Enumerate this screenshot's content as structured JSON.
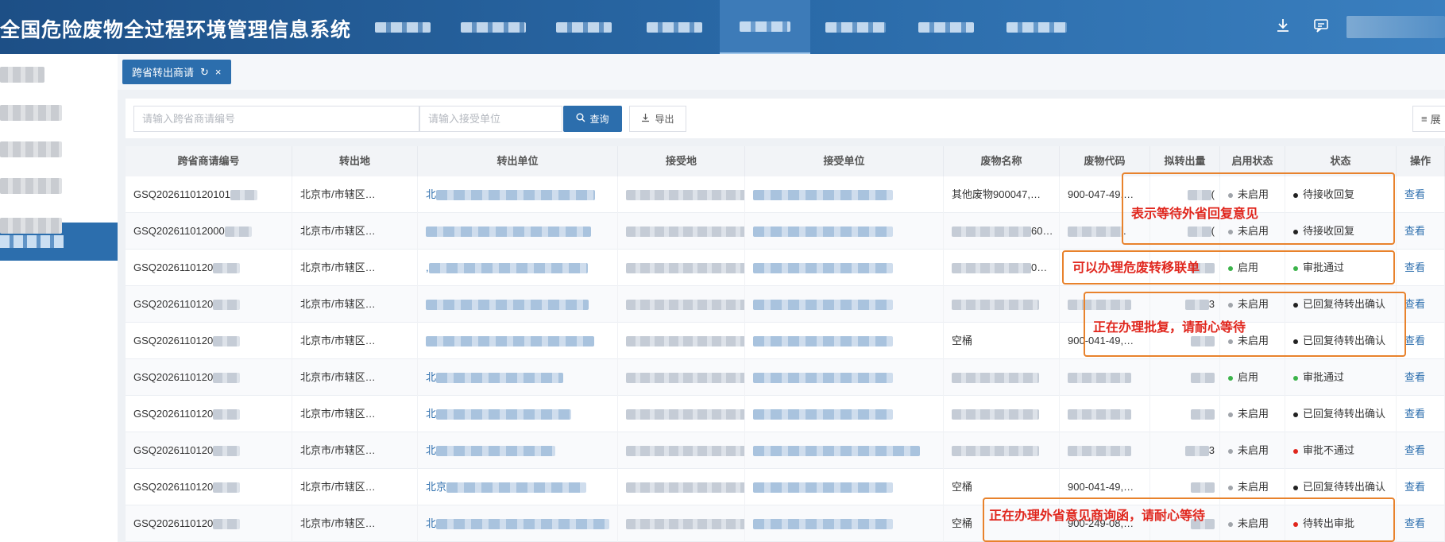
{
  "header": {
    "title": "全国危险废物全过程环境管理信息系统",
    "nav_count": 8,
    "active_nav_index": 4,
    "icons": [
      "download-icon",
      "message-icon"
    ]
  },
  "tabs": [
    {
      "label": "跨省转出商请",
      "refresh_icon": "↻",
      "close_icon": "×"
    }
  ],
  "search": {
    "apply_no_placeholder": "请输入跨省商请编号",
    "receiver_placeholder": "请输入接受单位",
    "query_label": "查询",
    "export_label": "导出",
    "right_label": "展"
  },
  "table": {
    "columns": [
      "跨省商请编号",
      "转出地",
      "转出单位",
      "接受地",
      "接受单位",
      "废物名称",
      "废物代码",
      "拟转出量",
      "启用状态",
      "状态",
      "操作"
    ],
    "rows": [
      {
        "id": "GSQ2026110120101",
        "origin": "北京市/市辖区…",
        "unit": "北",
        "waste_name": "其他废物900047,…",
        "waste_code": "900-047-49,…",
        "amount": "(",
        "enabled": "未启用",
        "status": "待接收回复",
        "action": "查看"
      },
      {
        "id": "GSQ202611012000",
        "origin": "北京市/市辖区…",
        "unit": "",
        "waste_name": "60…",
        "waste_code": ".",
        "amount": "(",
        "enabled": "未启用",
        "status": "待接收回复",
        "action": "查看"
      },
      {
        "id": "GSQ2026110120",
        "origin": "北京市/市辖区…",
        "unit": ",",
        "waste_name": "0…",
        "waste_code": "",
        "amount": "",
        "enabled": "启用",
        "status": "审批通过",
        "action": "查看"
      },
      {
        "id": "GSQ2026110120",
        "origin": "北京市/市辖区…",
        "unit": "",
        "waste_name": "",
        "waste_code": "",
        "amount": "3",
        "enabled": "未启用",
        "status": "已回复待转出确认",
        "action": "查看"
      },
      {
        "id": "GSQ2026110120",
        "origin": "北京市/市辖区…",
        "unit": "",
        "waste_name": "空桶",
        "waste_code": "900-041-49,…",
        "amount": "",
        "enabled": "未启用",
        "status": "已回复待转出确认",
        "action": "查看"
      },
      {
        "id": "GSQ2026110120",
        "origin": "北京市/市辖区…",
        "unit": "北",
        "waste_name": "",
        "waste_code": "",
        "amount": "",
        "enabled": "启用",
        "status": "审批通过",
        "action": "查看"
      },
      {
        "id": "GSQ2026110120",
        "origin": "北京市/市辖区…",
        "unit": "北",
        "waste_name": "",
        "waste_code": "",
        "amount": "",
        "enabled": "未启用",
        "status": "已回复待转出确认",
        "action": "查看"
      },
      {
        "id": "GSQ2026110120",
        "origin": "北京市/市辖区…",
        "unit": "北",
        "waste_name": "",
        "waste_code": "",
        "amount": "3",
        "enabled": "未启用",
        "status": "审批不通过",
        "action": "查看"
      },
      {
        "id": "GSQ2026110120",
        "origin": "北京市/市辖区…",
        "unit": "北京",
        "waste_name": "空桶",
        "waste_code": "900-041-49,…",
        "amount": "",
        "enabled": "未启用",
        "status": "已回复待转出确认",
        "action": "查看"
      },
      {
        "id": "GSQ2026110120",
        "origin": "北京市/市辖区…",
        "unit": "北",
        "waste_name": "空桶",
        "waste_code": "900-249-08,…",
        "amount": "",
        "enabled": "未启用",
        "status": "待转出审批",
        "action": "查看"
      }
    ]
  },
  "status_colors": {
    "未启用": "#a0a4aa",
    "启用": "#3bb34a",
    "待接收回复": "#222222",
    "审批通过": "#3bb34a",
    "已回复待转出确认": "#222222",
    "审批不通过": "#e0261d",
    "待转出审批": "#e0261d"
  },
  "annotations": [
    {
      "text": "表示等待外省回复意见"
    },
    {
      "text": "可以办理危废转移联单"
    },
    {
      "text": "正在办理批复，请耐心等待"
    },
    {
      "text": "正在办理外省意见商询函，请耐心等待"
    }
  ]
}
